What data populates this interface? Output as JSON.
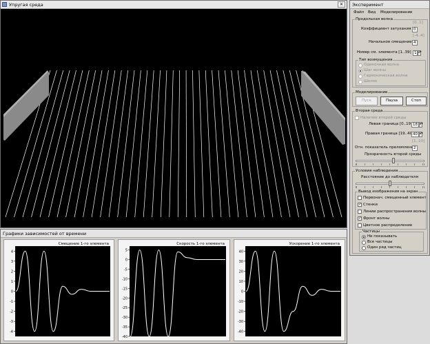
{
  "sim_window": {
    "title": "Упругая среда",
    "bg_color": "#000000",
    "wall_color": "#808080",
    "string_color": "#ffffff"
  },
  "graphs_window": {
    "title": "Графики зависимостей от времени",
    "line_color": "#ffffff",
    "panel_bg": "#000000"
  },
  "experiment_window": {
    "title": "Эксперимент",
    "menu": [
      "Файл",
      "Вид",
      "Моделирование"
    ],
    "longitudinal_wave": {
      "label": "Продольная волна",
      "attenuation_range": "[0..1]",
      "attenuation_label": "Коэффициент затухания",
      "attenuation_value": "0",
      "offset_range": "[-4..4]",
      "offset_label": "Начальное смещение",
      "offset_value": "4",
      "element_label": "Номер см. элемента  [1..39]",
      "element_value": "1",
      "excitation": {
        "label": "Тип возмущения",
        "options": [
          "Одиночная волна",
          "Шаг волны",
          "Гармоническая волна",
          "Шелок"
        ],
        "selected_index": 1
      }
    },
    "modeling": {
      "label": "Моделирование",
      "start_label": "Пуск",
      "pause_label": "Пауза",
      "stop_label": "Стоп"
    },
    "second_medium": {
      "label": "Вторая среда",
      "presence_label": "Наличие второй среды",
      "presence_checked": false,
      "left_bound_label": "Левая граница  [0..19]",
      "left_bound_value": "18",
      "right_bound_label": "Правая граница  [19..40]",
      "right_bound_value": "40",
      "refr_range": "[1..10]",
      "refr_label": "Отн. показатель преломления",
      "refr_value": "2",
      "transparency_label": "Прозрачность второй среды",
      "transparency_level": 0.55
    },
    "observation": {
      "label": "Условия наблюдения",
      "distance_label": "Расстояние до наблюдателя",
      "distance_level": 0.5,
      "output": {
        "label": "Вывод изображения на экран",
        "items": [
          {
            "label": "Первонач. смещенный элемент",
            "checked": false
          },
          {
            "label": "Стенки",
            "checked": true
          },
          {
            "label": "Линии распространения волны",
            "checked": false
          },
          {
            "label": "Фронт волны",
            "checked": true
          },
          {
            "label": "Цветное распределение",
            "checked": false
          }
        ]
      },
      "particles": {
        "label": "Частицы",
        "options": [
          "Не показывать",
          "Все частицы",
          "Один ряд частиц"
        ],
        "selected_index": 0
      }
    }
  },
  "chart_data": [
    {
      "type": "line",
      "title": "Смещение 1-го элемента",
      "ylim": [
        -4.5,
        4.5
      ],
      "yticks": [
        "4",
        "3",
        "2",
        "1",
        "0",
        "-1",
        "-2",
        "-3",
        "-4"
      ],
      "series": [
        {
          "values": [
            0,
            4,
            -4,
            4,
            -4,
            0.5,
            -0.3,
            0.2,
            0,
            0,
            0
          ]
        }
      ]
    },
    {
      "type": "line",
      "title": "Скорость 1-го элемента",
      "ylim": [
        -40,
        7
      ],
      "yticks": [
        "5",
        "0",
        "-5",
        "-10",
        "-15",
        "-20",
        "-25",
        "-30",
        "-35",
        "-40"
      ],
      "series": [
        {
          "values": [
            -40,
            5,
            -40,
            5,
            -40,
            4,
            1,
            0,
            0,
            0,
            0
          ]
        }
      ]
    },
    {
      "type": "line",
      "title": "Ускорение 1-го элемента",
      "ylim": [
        -45,
        45
      ],
      "yticks": [
        "40",
        "30",
        "20",
        "10",
        "0",
        "-10",
        "-20",
        "-30",
        "-40"
      ],
      "series": [
        {
          "values": [
            0,
            40,
            -40,
            40,
            -40,
            -20,
            5,
            -4,
            2,
            0,
            0
          ]
        }
      ]
    }
  ]
}
